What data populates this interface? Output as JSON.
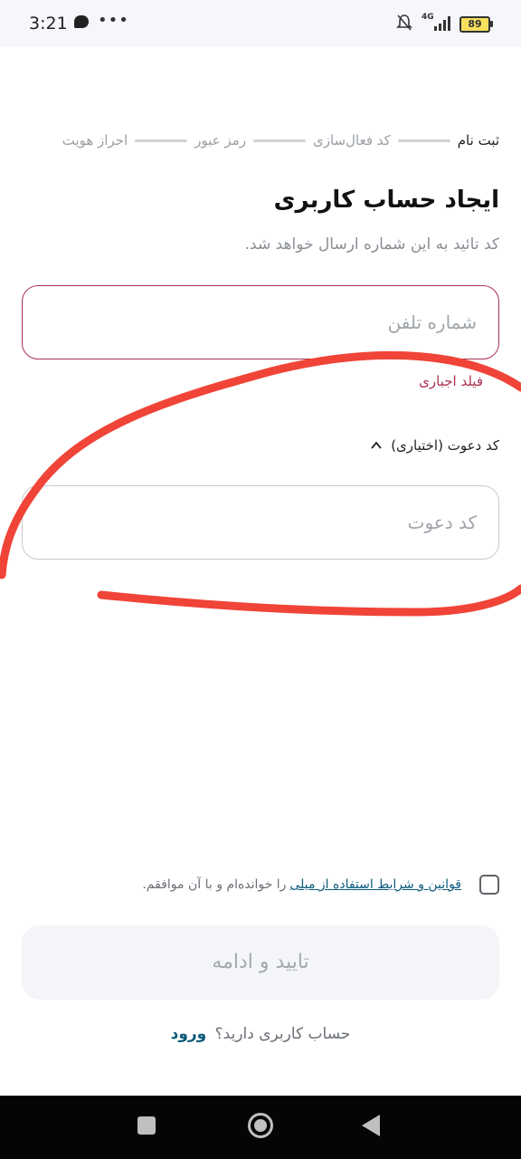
{
  "status_bar": {
    "time": "3:21",
    "dots": "•••",
    "network": "4G",
    "battery": "89"
  },
  "stepper": {
    "steps": [
      "ثبت نام",
      "کد فعال‌سازی",
      "رمز عبور",
      "احراز هویت"
    ],
    "active_index": 0
  },
  "header": {
    "title": "ایجاد حساب کاربری",
    "subtitle": "کد تائید به این شماره ارسال خواهد شد."
  },
  "phone_field": {
    "placeholder": "شماره تلفن",
    "value": "",
    "error": "فیلد اجباری"
  },
  "invite": {
    "toggle_label": "کد دعوت (اختیاری)",
    "placeholder": "کد دعوت",
    "value": ""
  },
  "terms": {
    "link_text": "قوانین و شرایط استفاده از میلی",
    "rest_text": "را خوانده‌ام و با آن موافقم."
  },
  "actions": {
    "confirm_label": "تایید و ادامه",
    "login_prompt": "حساب کاربری دارید؟",
    "login_link": "ورود"
  },
  "colors": {
    "error": "#a9324f",
    "link": "#0b5a7a",
    "scribble": "#f04438"
  }
}
